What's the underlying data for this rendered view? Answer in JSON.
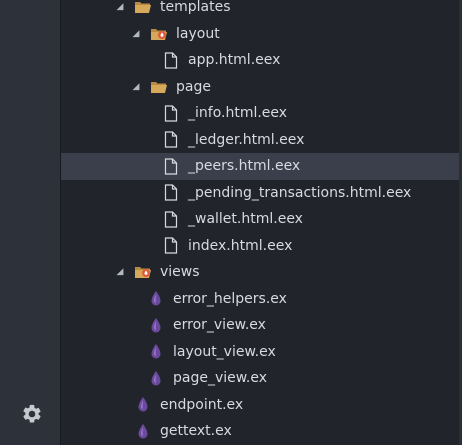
{
  "sidebar": {
    "settings_icon": "gear-icon"
  },
  "tree": {
    "templates": {
      "label": "templates",
      "icon": "folder-open-icon"
    },
    "layout": {
      "label": "layout",
      "icon": "folder-open-icon"
    },
    "app_html_eex": {
      "label": "app.html.eex",
      "icon": "file-icon"
    },
    "page": {
      "label": "page",
      "icon": "folder-open-icon"
    },
    "info_html_eex": {
      "label": "_info.html.eex",
      "icon": "file-icon"
    },
    "ledger_html_eex": {
      "label": "_ledger.html.eex",
      "icon": "file-icon"
    },
    "peers_html_eex": {
      "label": "_peers.html.eex",
      "icon": "file-icon"
    },
    "pending_transactions_html_eex": {
      "label": "_pending_transactions.html.eex",
      "icon": "file-icon"
    },
    "wallet_html_eex": {
      "label": "_wallet.html.eex",
      "icon": "file-icon"
    },
    "index_html_eex": {
      "label": "index.html.eex",
      "icon": "file-icon"
    },
    "views": {
      "label": "views",
      "icon": "folder-open-icon"
    },
    "error_helpers_ex": {
      "label": "error_helpers.ex",
      "icon": "elixir-drop-icon"
    },
    "error_view_ex": {
      "label": "error_view.ex",
      "icon": "elixir-drop-icon"
    },
    "layout_view_ex": {
      "label": "layout_view.ex",
      "icon": "elixir-drop-icon"
    },
    "page_view_ex": {
      "label": "page_view.ex",
      "icon": "elixir-drop-icon"
    },
    "endpoint_ex": {
      "label": "endpoint.ex",
      "icon": "elixir-drop-icon"
    },
    "gettext_ex": {
      "label": "gettext.ex",
      "icon": "elixir-drop-icon"
    }
  },
  "colors": {
    "background": "#21252b",
    "activity_bar": "#2c313a",
    "selected_row": "#3a3f4b",
    "folder": "#d6a85a",
    "folder_badge": "#e05a3a",
    "elixir": "#8b5fbf",
    "text": "#d7dae0"
  }
}
